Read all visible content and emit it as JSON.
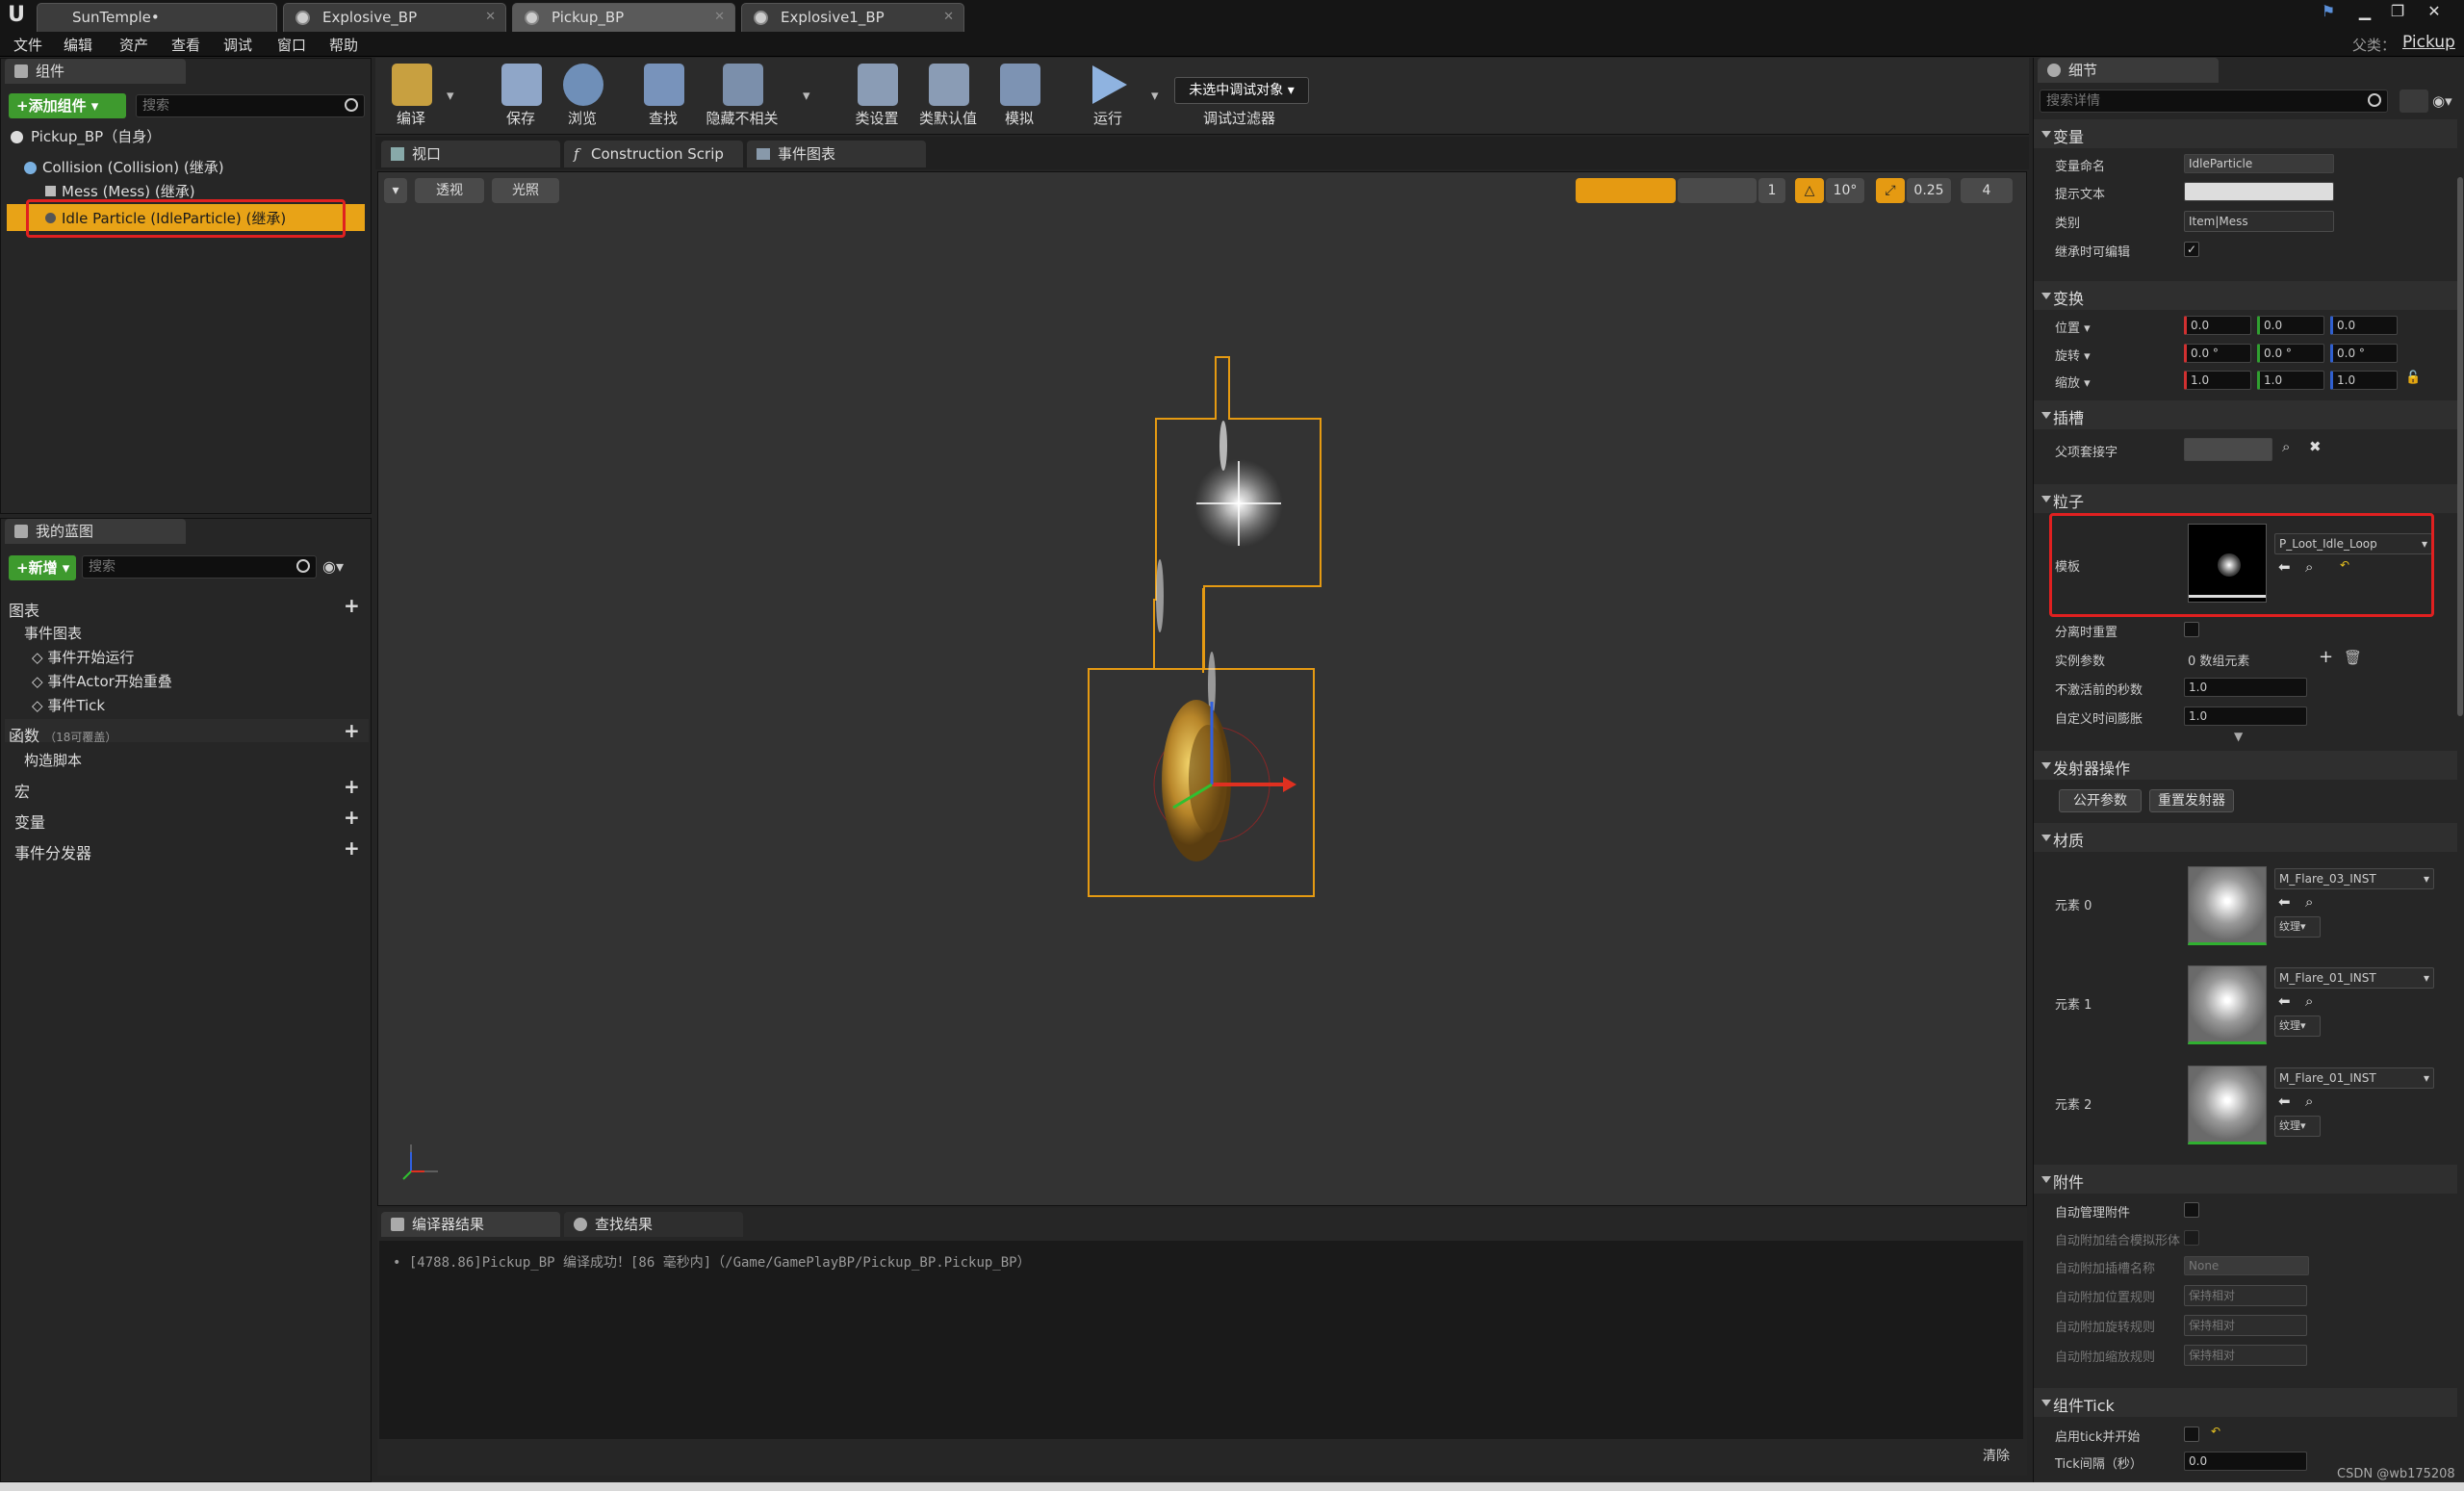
{
  "tabs": [
    {
      "label": "SunTemple•"
    },
    {
      "label": "Explosive_BP"
    },
    {
      "label": "Pickup_BP"
    },
    {
      "label": "Explosive1_BP"
    }
  ],
  "menu": [
    "文件",
    "编辑",
    "资产",
    "查看",
    "调试",
    "窗口",
    "帮助"
  ],
  "parent_label": "父类：",
  "parent_value": "Pickup",
  "components": {
    "tab": "组件",
    "add_button": "+添加组件 ▾",
    "search_placeholder": "搜索",
    "root": "Pickup_BP（自身）",
    "items": [
      "Collision (Collision) (继承)",
      "Mess (Mess) (继承)",
      "Idle Particle (IdleParticle) (继承)"
    ]
  },
  "myblueprint": {
    "tab": "我的蓝图",
    "new_button": "+新增 ▾",
    "search_placeholder": "搜索",
    "graphs": "图表",
    "event_graph": "事件图表",
    "events": [
      "事件开始运行",
      "事件Actor开始重叠",
      "事件Tick"
    ],
    "functions": "函数",
    "functions_note": "（18可覆盖）",
    "construction": "构造脚本",
    "macros": "宏",
    "variables": "变量",
    "dispatchers": "事件分发器"
  },
  "toolbar": [
    {
      "label": "编译"
    },
    {
      "label": "保存"
    },
    {
      "label": "浏览"
    },
    {
      "label": "查找"
    },
    {
      "label": "隐藏不相关"
    },
    {
      "label": "类设置"
    },
    {
      "label": "类默认值"
    },
    {
      "label": "模拟"
    },
    {
      "label": "运行"
    }
  ],
  "debug": {
    "select": "未选中调试对象 ▾",
    "label": "调试过滤器"
  },
  "editor_tabs": [
    {
      "label": "视口"
    },
    {
      "label": "Construction Scrip"
    },
    {
      "label": "事件图表"
    }
  ],
  "viewport": {
    "perspective": "透视",
    "lighting": "光照",
    "grid_snap": "10°",
    "scale_snap": "0.25",
    "cam_speed": "4",
    "grid_count": "1"
  },
  "output": {
    "tabs": [
      "编译器结果",
      "查找结果"
    ],
    "log": "[4788.86]Pickup_BP 编译成功！[86 毫秒内]（/Game/GamePlayBP/Pickup_BP.Pickup_BP）",
    "clear": "清除"
  },
  "details": {
    "tab": "细节",
    "search_placeholder": "搜索详情",
    "sections": {
      "variable": "变量",
      "transform": "变换",
      "socket": "插槽",
      "particle": "粒子",
      "emitter_ops": "发射器操作",
      "materials": "材质",
      "attachment": "附件",
      "component_tick": "组件Tick"
    },
    "variable": {
      "name_label": "变量命名",
      "name_value": "IdleParticle",
      "tooltip_label": "提示文本",
      "category_label": "类别",
      "category_value": "Item|Mess",
      "editable_label": "继承时可编辑"
    },
    "transform": {
      "loc_label": "位置 ▾",
      "rot_label": "旋转 ▾",
      "scale_label": "缩放 ▾",
      "loc": [
        "0.0",
        "0.0",
        "0.0"
      ],
      "rot": [
        "0.0 °",
        "0.0 °",
        "0.0 °"
      ],
      "scale": [
        "1.0",
        "1.0",
        "1.0"
      ]
    },
    "socket": {
      "label": "父项套接字"
    },
    "particle": {
      "template_label": "模板",
      "template_value": "P_Loot_Idle_Loop",
      "reset_label": "分离时重置",
      "instance_label": "实例参数",
      "instance_value": "0 数组元素",
      "prewarm_label": "不激活前的秒数",
      "prewarm_value": "1.0",
      "dilation_label": "自定义时间膨胀",
      "dilation_value": "1.0"
    },
    "emitter": {
      "expose": "公开参数",
      "reset": "重置发射器"
    },
    "materials": [
      {
        "label": "元素 0",
        "value": "M_Flare_03_INST",
        "tex": "纹理▾"
      },
      {
        "label": "元素 1",
        "value": "M_Flare_01_INST",
        "tex": "纹理▾"
      },
      {
        "label": "元素 2",
        "value": "M_Flare_01_INST",
        "tex": "纹理▾"
      }
    ],
    "attachment": {
      "auto_manage": "自动管理附件",
      "auto_attach_sim": "自动附加结合模拟形体",
      "socket_name": "自动附加插槽名称",
      "socket_value": "None",
      "loc_rule": "自动附加位置规则",
      "rot_rule": "自动附加旋转规则",
      "scale_rule": "自动附加缩放规则",
      "rule_value": "保持相对"
    },
    "tick": {
      "start_label": "启用tick并开始",
      "interval_label": "Tick间隔（秒）",
      "interval_value": "0.0"
    }
  },
  "watermark": "CSDN @wb175208"
}
